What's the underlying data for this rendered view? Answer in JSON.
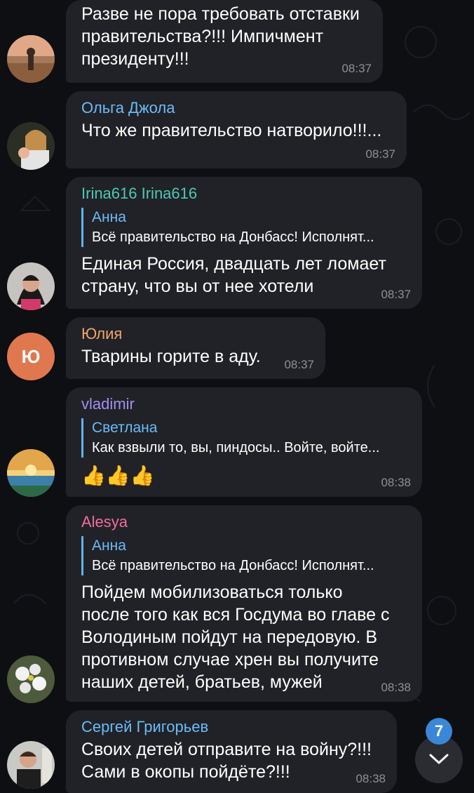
{
  "messages": [
    {
      "name": "",
      "text": "Разве не пора требовать отставки\nправительства?!!! Импичмент\nпрезиденту!!!",
      "time": "08:37"
    },
    {
      "name": "Ольга Джола",
      "name_color": "#6bbcf7",
      "text": "Что же правительство натворило!!!...",
      "time": "08:37"
    },
    {
      "name": "Irina616 Irina616",
      "name_color": "#4cc9b5",
      "reply": {
        "name": "Анна",
        "text": "Всё правительство на Донбасс! Исполнят..."
      },
      "text": "Единая Россия, двадцать лет ломает\nстрану, что вы от нее хотели",
      "time": "08:37"
    },
    {
      "name": "Юлия",
      "name_color": "#f0a36a",
      "avatar_letter": "Ю",
      "avatar_color": "#e0784f",
      "text": "Тварины горите в аду.",
      "time": "08:37"
    },
    {
      "name": "vladimir",
      "name_color": "#a48ff0",
      "reply": {
        "name": "Светлана",
        "text": "Как взвыли то, вы, пиндосы.. Войте, войте..."
      },
      "emoji": "👍👍👍",
      "time": "08:38"
    },
    {
      "name": "Alesya",
      "name_color": "#f06e9c",
      "reply": {
        "name": "Анна",
        "text": "Всё правительство на Донбасс! Исполнят..."
      },
      "text": "Пойдем мобилизоваться только\nпосле того как вся Госдума во главе с\nВолодиным пойдут на передовую. В\nпротивном случае хрен вы получите\nнаших детей, братьев, мужей",
      "time": "08:38"
    },
    {
      "name": "Сергей Григорьев",
      "name_color": "#6bbcf7",
      "text": "Своих детей отправите на войну?!!!\nСами в окопы пойдёте?!!!",
      "time": "08:38"
    }
  ],
  "unread_badge": "7",
  "icons": {
    "scroll_down": "chevron-down-icon"
  }
}
